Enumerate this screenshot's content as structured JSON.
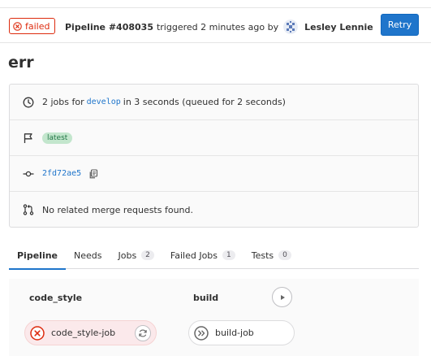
{
  "header": {
    "status": "failed",
    "pipeline_id": "Pipeline #408035",
    "triggered_text": "triggered 2 minutes ago by",
    "author": "Lesley Lennie",
    "retry_label": "Retry"
  },
  "title": "err",
  "info": {
    "jobs_prefix": "2 jobs for",
    "branch": "develop",
    "jobs_suffix": "in 3 seconds (queued for 2 seconds)",
    "latest_badge": "latest",
    "commit_sha": "2fd72ae5",
    "merge_requests": "No related merge requests found."
  },
  "tabs": [
    {
      "label": "Pipeline"
    },
    {
      "label": "Needs"
    },
    {
      "label": "Jobs",
      "count": "2"
    },
    {
      "label": "Failed Jobs",
      "count": "1"
    },
    {
      "label": "Tests",
      "count": "0"
    }
  ],
  "stages": [
    {
      "name": "code_style",
      "job": "code_style-job"
    },
    {
      "name": "build",
      "job": "build-job"
    }
  ],
  "colors": {
    "failed": "#dd2b0e",
    "primary": "#1f75cb",
    "latest_bg": "#c3e6cd"
  }
}
